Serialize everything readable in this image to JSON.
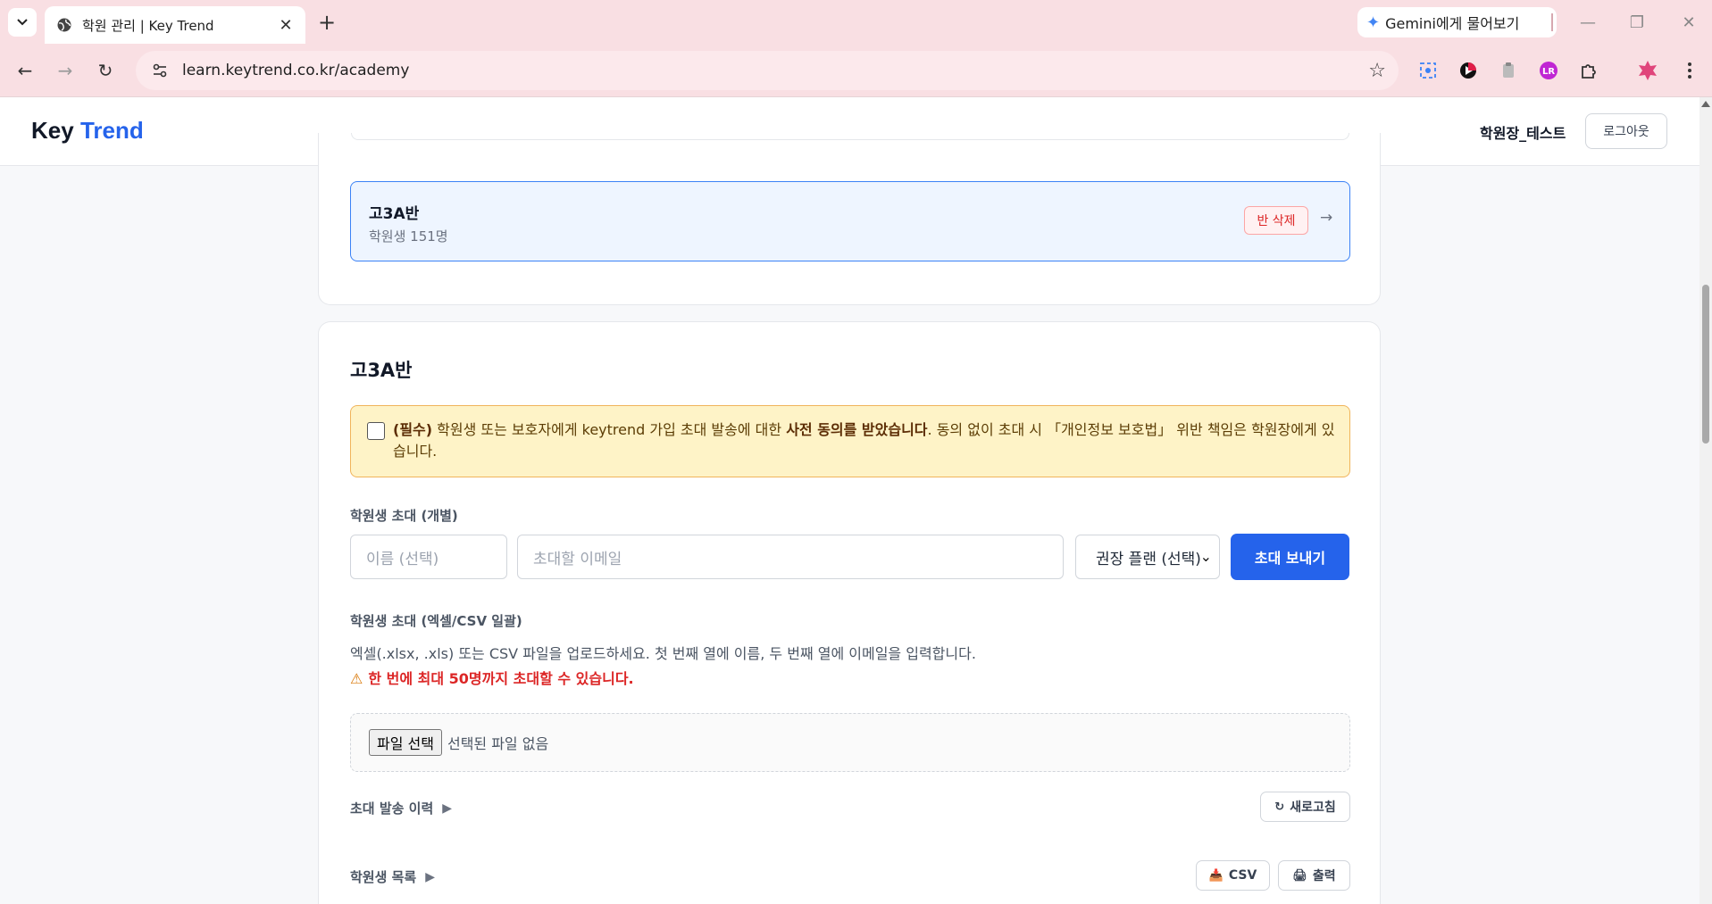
{
  "browser": {
    "tab_title": "학원 관리 | Key Trend",
    "url": "learn.keytrend.co.kr/academy",
    "gemini_label": "Gemini에게 물어보기"
  },
  "header": {
    "logo_main": "Key",
    "logo_accent": "Trend",
    "user_name": "학원장_테스트",
    "logout_label": "로그아웃"
  },
  "class_list": {
    "items": [
      {
        "name": "고3A반",
        "count_text": "학원생 151명",
        "delete_label": "반 삭제",
        "arrow": "→"
      }
    ]
  },
  "detail": {
    "title": "고3A반",
    "consent": {
      "required": "(필수)",
      "text_before": " 학원생 또는 보호자에게 keytrend 가입 초대 발송에 대한 ",
      "bold": "사전 동의를 받았습니다",
      "text_after": ". 동의 없이 초대 시 「개인정보 보호법」 위반 책임은 학원장에게 있습니다."
    },
    "invite_single": {
      "label": "학원생 초대 (개별)",
      "name_placeholder": "이름 (선택)",
      "email_placeholder": "초대할 이메일",
      "plan_value": "권장 플랜 (선택)",
      "send_label": "초대 보내기"
    },
    "invite_bulk": {
      "label": "학원생 초대 (엑셀/CSV 일괄)",
      "help": "엑셀(.xlsx, .xls) 또는 CSV 파일을 업로드하세요. 첫 번째 열에 이름, 두 번째 열에 이메일을 입력합니다.",
      "warning": "한 번에 최대 50명까지 초대할 수 있습니다.",
      "file_button": "파일 선택",
      "file_status": "선택된 파일 없음"
    },
    "history": {
      "label": "초대 발송 이력",
      "refresh_label": "새로고침"
    },
    "students": {
      "label": "학원생 목록",
      "csv_label": "CSV",
      "print_label": "출력"
    }
  },
  "colors": {
    "accent": "#2563eb",
    "danger": "#dc2626",
    "warning_bg": "#fef3c7",
    "chrome_bg": "#f9dfe3"
  }
}
